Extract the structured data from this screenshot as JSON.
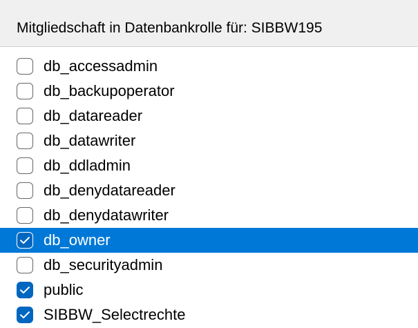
{
  "header": {
    "title": "Mitgliedschaft in Datenbankrolle für: SIBBW195"
  },
  "roles": [
    {
      "label": "db_accessadmin",
      "checked": false,
      "selected": false
    },
    {
      "label": "db_backupoperator",
      "checked": false,
      "selected": false
    },
    {
      "label": "db_datareader",
      "checked": false,
      "selected": false
    },
    {
      "label": "db_datawriter",
      "checked": false,
      "selected": false
    },
    {
      "label": "db_ddladmin",
      "checked": false,
      "selected": false
    },
    {
      "label": "db_denydatareader",
      "checked": false,
      "selected": false
    },
    {
      "label": "db_denydatawriter",
      "checked": false,
      "selected": false
    },
    {
      "label": "db_owner",
      "checked": true,
      "selected": true
    },
    {
      "label": "db_securityadmin",
      "checked": false,
      "selected": false
    },
    {
      "label": "public",
      "checked": true,
      "selected": false
    },
    {
      "label": "SIBBW_Selectrechte",
      "checked": true,
      "selected": false
    }
  ],
  "colors": {
    "selection": "#0078d7",
    "checked_box": "#0067c0",
    "header_background": "#f0f0f0"
  },
  "icons": {
    "checkbox": "checkbox-icon",
    "checkmark": "checkmark-icon"
  }
}
